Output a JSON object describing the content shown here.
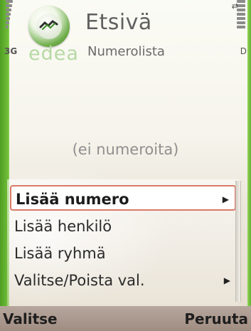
{
  "status": {
    "network": "3G",
    "battery_label": "D",
    "usb_icon": "usb-connection-icon"
  },
  "header": {
    "title": "Etsivä",
    "brand": "edea",
    "subtitle": "Numerolista",
    "app_icon": "telephone-directory-icon"
  },
  "main": {
    "empty_text": "(ei numeroita)"
  },
  "menu": {
    "items": [
      {
        "label": "Lisää numero",
        "selected": true,
        "submenu": true
      },
      {
        "label": "Lisää henkilö",
        "selected": false,
        "submenu": false
      },
      {
        "label": "Lisää ryhmä",
        "selected": false,
        "submenu": false
      },
      {
        "label": "Valitse/Poista val.",
        "selected": false,
        "submenu": true
      }
    ]
  },
  "softkeys": {
    "left": "Valitse",
    "right": "Peruuta"
  },
  "colors": {
    "frame_green": "#6fbd38",
    "highlight_border": "#d97a68",
    "softkey_bar": "#a08d82"
  }
}
